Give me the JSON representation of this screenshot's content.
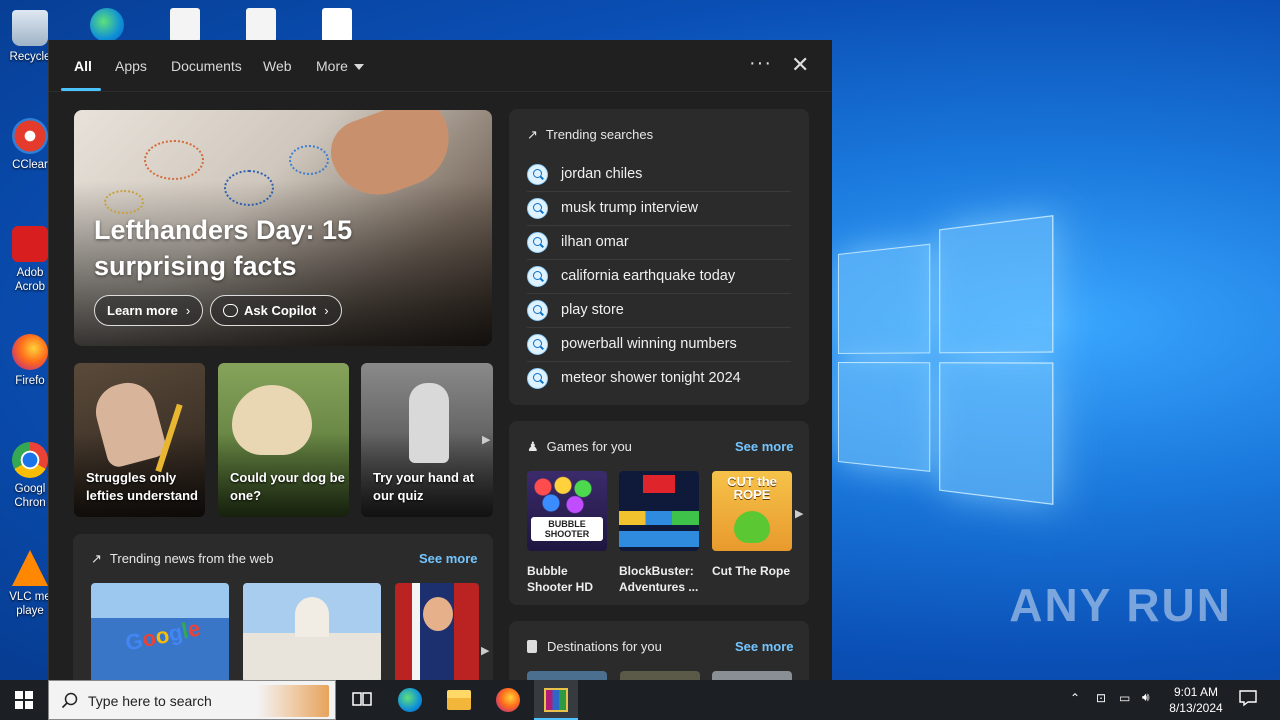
{
  "desktop": {
    "icons": [
      {
        "label": "Recycle",
        "icon": "recycle-bin-icon"
      },
      {
        "label": "CClear",
        "icon": "ccleaner-icon"
      },
      {
        "label": "Adob Acrob",
        "icon": "acrobat-icon"
      },
      {
        "label": "Firefo",
        "icon": "firefox-icon"
      },
      {
        "label": "Googl Chron",
        "icon": "chrome-icon"
      },
      {
        "label": "VLC me playe",
        "icon": "vlc-icon"
      }
    ],
    "watermark": "ANY RUN"
  },
  "search_panel": {
    "tabs": [
      "All",
      "Apps",
      "Documents",
      "Web",
      "More"
    ],
    "hero": {
      "title": "Lefthanders Day: 15 surprising facts",
      "learn_more": "Learn more",
      "ask_copilot": "Ask Copilot"
    },
    "cards": [
      {
        "caption": "Struggles only lefties understand"
      },
      {
        "caption": "Could your dog be one?"
      },
      {
        "caption": "Try your hand at our quiz"
      }
    ],
    "trending_news": {
      "title": "Trending news from the web",
      "see_more": "See more"
    },
    "trending_searches": {
      "title": "Trending searches",
      "items": [
        "jordan chiles",
        "musk trump interview",
        "ilhan omar",
        "california earthquake today",
        "play store",
        "powerball winning numbers",
        "meteor shower tonight 2024"
      ]
    },
    "games": {
      "title": "Games for you",
      "see_more": "See more",
      "items": [
        {
          "name": "Bubble Shooter HD",
          "logo": "BUBBLE SHOOTER"
        },
        {
          "name": "BlockBuster: Adventures ..."
        },
        {
          "name": "Cut The Rope",
          "logo": "CUT the ROPE"
        }
      ]
    },
    "destinations": {
      "title": "Destinations for you",
      "see_more": "See more"
    }
  },
  "taskbar": {
    "search_placeholder": "Type here to search",
    "time": "9:01 AM",
    "date": "8/13/2024"
  },
  "colors": {
    "accent": "#4cc2ff",
    "link": "#73c6ff",
    "panel_bg": "#202020",
    "box_bg": "#2b2b2b"
  }
}
